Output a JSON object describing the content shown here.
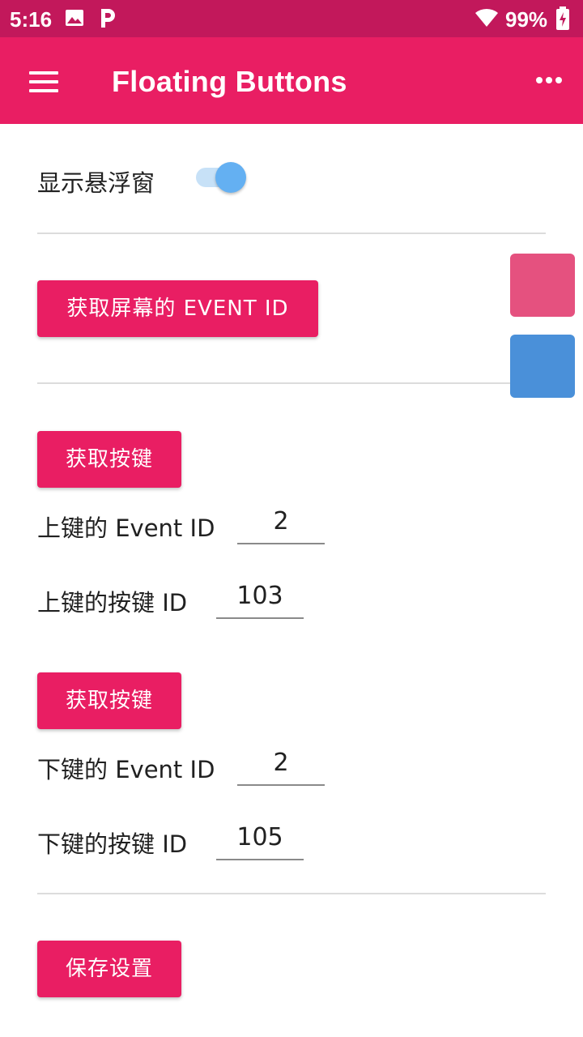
{
  "status_bar": {
    "time": "5:16",
    "battery_percent": "99%",
    "icons": [
      "image-icon",
      "p-icon",
      "wifi-icon",
      "battery-charging-icon"
    ]
  },
  "app_bar": {
    "title": "Floating Buttons",
    "color": "#e91e63",
    "status_color": "#c2185b"
  },
  "settings": {
    "show_floating_label": "显示悬浮窗",
    "show_floating_on": true,
    "get_screen_event_button": "获取屏幕的 EVENT ID",
    "up": {
      "get_key_button": "获取按键",
      "event_id_label": "上键的 Event ID",
      "event_id_value": "2",
      "key_id_label": "上键的按键 ID",
      "key_id_value": "103"
    },
    "down": {
      "get_key_button": "获取按键",
      "event_id_label": "下键的 Event ID",
      "event_id_value": "2",
      "key_id_label": "下键的按键 ID",
      "key_id_value": "105"
    },
    "save_button": "保存设置"
  },
  "floating_buttons": {
    "up_color": "#e5517f",
    "down_color": "#4a90d9"
  }
}
